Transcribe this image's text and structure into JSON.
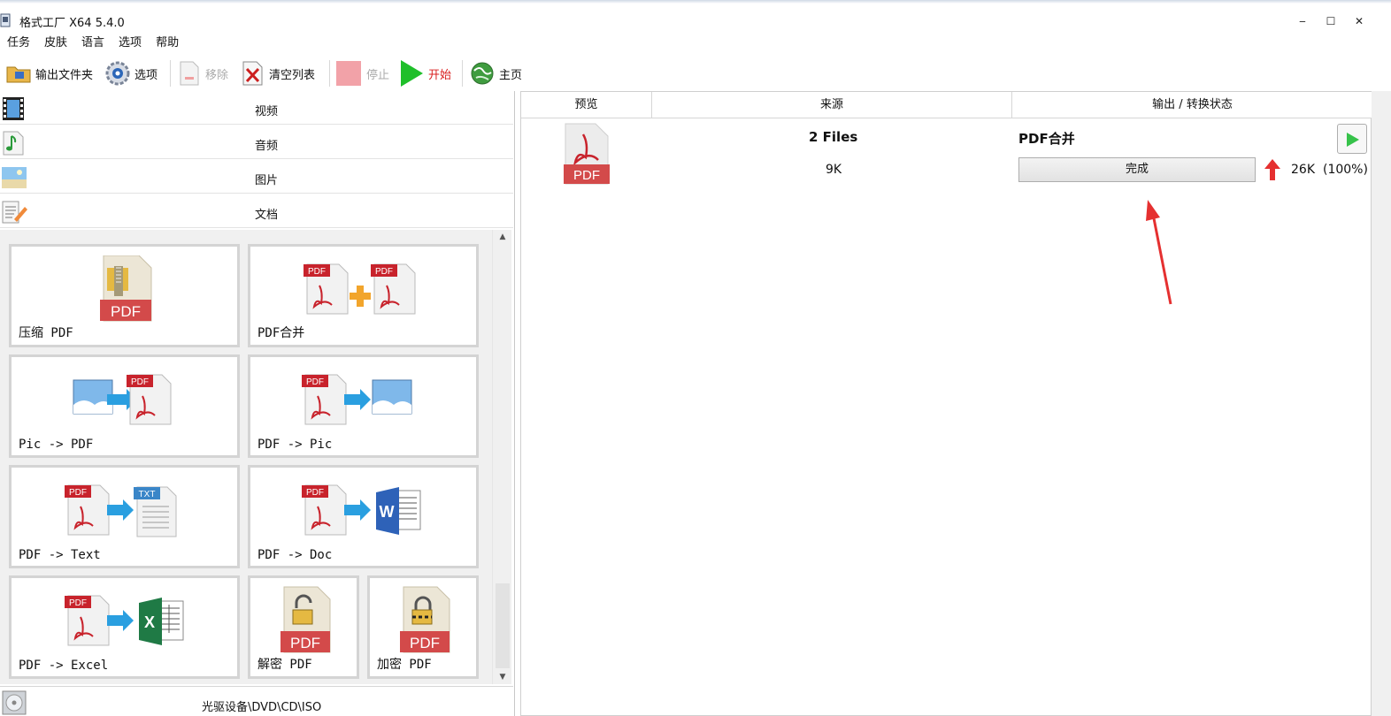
{
  "window": {
    "title": "格式工厂 X64 5.4.0",
    "minimize": "‒",
    "maximize": "☐",
    "close": "✕"
  },
  "menu": [
    "任务",
    "皮肤",
    "语言",
    "选项",
    "帮助"
  ],
  "toolbar": {
    "output_folder": "输出文件夹",
    "options": "选项",
    "remove": "移除",
    "clear_list": "清空列表",
    "stop": "停止",
    "start": "开始",
    "home": "主页"
  },
  "categories": [
    "视频",
    "音频",
    "图片",
    "文档"
  ],
  "tiles": [
    "压缩 PDF",
    "PDF合并",
    "Pic -> PDF",
    "PDF -> Pic",
    "PDF -> Text",
    "PDF -> Doc",
    "PDF -> Excel",
    "解密 PDF",
    "加密 PDF"
  ],
  "bottom_category": "光驱设备\\DVD\\CD\\ISO",
  "table": {
    "headers": [
      "预览",
      "来源",
      "输出 / 转换状态"
    ],
    "row": {
      "source_title": "2 Files",
      "source_size": "9K",
      "output_title": "PDF合并",
      "status": "完成",
      "output_size": "26K",
      "percent": "(100%)"
    }
  },
  "colors": {
    "pdf_red": "#d34a4a",
    "start_green": "#1fbf2a",
    "stop_pink": "#f2a2a8",
    "arrow_red": "#e53030"
  }
}
